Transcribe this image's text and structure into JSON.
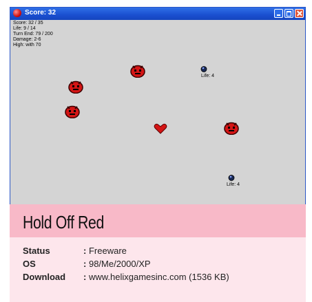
{
  "window": {
    "title": "Score: 32",
    "controls": {
      "minimize": "minimize",
      "maximize": "maximize",
      "close": "close"
    }
  },
  "stats": {
    "score": "Score: 32 / 35",
    "life": "Life: 9 / 14",
    "turn_end": "Turn End: 79 / 200",
    "damage": "Damage: 2-6",
    "high": "High:  with 70"
  },
  "units": [
    {
      "life_label": "Life: 4"
    },
    {
      "life_label": "Life: 4"
    }
  ],
  "info": {
    "game_title": "Hold Off Red",
    "rows": [
      {
        "label": "Status",
        "sep": ":",
        "value": "Freeware"
      },
      {
        "label": "OS",
        "sep": ":",
        "value": "98/Me/2000/XP"
      },
      {
        "label": "Download",
        "sep": ":",
        "value": "www.helixgamesinc.com (1536 KB)"
      }
    ]
  },
  "colors": {
    "title_banner": "#f8b9c8",
    "info_panel": "#fde6ec",
    "enemy_red": "#d41515",
    "titlebar_blue": "#1a4fd0"
  }
}
